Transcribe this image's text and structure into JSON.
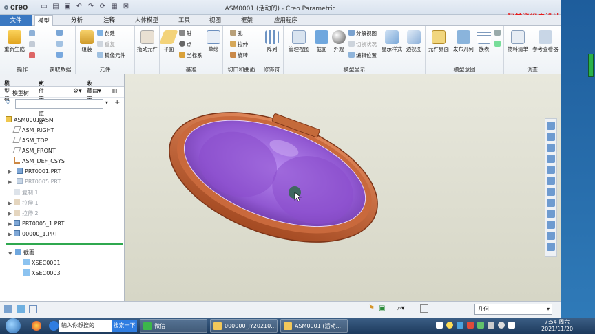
{
  "title_bar": {
    "logo": "creo",
    "window_title": "ASM0001 (活动的) - Creo Parametric",
    "overlay_text": "阿甘瓷钢中设计教程"
  },
  "tabs": [
    "文件",
    "模型",
    "分析",
    "注释",
    "人体模型",
    "工具",
    "视图",
    "框架",
    "应用程序"
  ],
  "ribbon": {
    "groups": {
      "operations": "操作",
      "get_data": "获取数据",
      "component": "元件",
      "datum": "基准",
      "cut_surface": "切口和曲面",
      "modifiers": "修饰符",
      "model_display": "模型显示",
      "model_intent": "模型意图",
      "investigate": "调查"
    },
    "buttons": {
      "regenerate": "重新生成",
      "assemble": "组装",
      "create": "创建",
      "repeat": "重复",
      "mirror_component": "镜像元件",
      "drag_components": "拖动元件",
      "plane": "平面",
      "axis": "轴",
      "point": "点",
      "csys": "坐标系",
      "sketch": "草绘",
      "hole": "孔",
      "extrude": "拉伸",
      "revolve": "旋转",
      "pattern": "阵列",
      "manage_views": "管理视图",
      "section": "截面",
      "appearance": "外观",
      "exploded_view": "分解视图",
      "toggle_status": "切换状况",
      "edit_position": "编辑位置",
      "display_style": "显示样式",
      "perspective": "透视图",
      "component_interface": "元件界面",
      "publish_geometry": "发布几何",
      "family_table": "族表",
      "bom": "物料清单",
      "reference_viewer": "参考查看器"
    }
  },
  "left_pane": {
    "tabs": [
      "模型树",
      "文件夹浏览器",
      "收藏夹"
    ],
    "header": "模型树",
    "filter_placeholder": "",
    "tree": [
      {
        "label": "ASM0001.ASM",
        "kind": "asm",
        "grey": false
      },
      {
        "label": "ASM_RIGHT",
        "kind": "plane",
        "grey": false
      },
      {
        "label": "ASM_TOP",
        "kind": "plane",
        "grey": false
      },
      {
        "label": "ASM_FRONT",
        "kind": "plane",
        "grey": false
      },
      {
        "label": "ASM_DEF_CSYS",
        "kind": "csys",
        "grey": false
      },
      {
        "label": "PRT0001.PRT",
        "kind": "part",
        "grey": false
      },
      {
        "label": "PRT0005.PRT",
        "kind": "part",
        "grey": true
      },
      {
        "label": "复制 1",
        "kind": "feat",
        "grey": true
      },
      {
        "label": "拉伸 1",
        "kind": "feat",
        "grey": true
      },
      {
        "label": "拉伸 2",
        "kind": "feat",
        "grey": true
      },
      {
        "label": "PRT0005_1.PRT",
        "kind": "part",
        "grey": false
      },
      {
        "label": "00000_1.PRT",
        "kind": "part",
        "grey": false
      }
    ],
    "sections_header": "截面",
    "sections": [
      "XSEC0001",
      "XSEC0003"
    ]
  },
  "status_bar": {
    "filter_value": "几何"
  },
  "taskbar": {
    "search_placeholder": "输入你想搜的",
    "search_button": "搜索一下",
    "items": [
      "微信",
      "000000_JY20210...",
      "ASM0001 (活动..."
    ],
    "time": "7:54 周六",
    "date": "2021/11/20"
  },
  "colors": {
    "shell_outer": "#c8643a",
    "cavity": "#a066d8",
    "file_tab": "#3a78c2"
  }
}
